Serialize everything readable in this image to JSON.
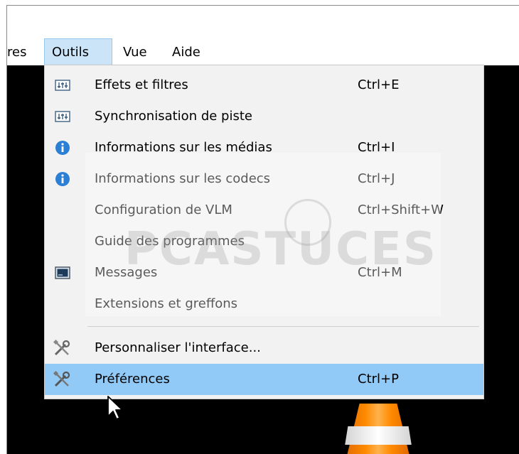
{
  "menubar": {
    "items": [
      {
        "label": "res"
      },
      {
        "label": "Outils"
      },
      {
        "label": "Vue"
      },
      {
        "label": "Aide"
      }
    ]
  },
  "menu": {
    "items": [
      {
        "label": "Effets et filtres",
        "shortcut": "Ctrl+E",
        "icon": "equalizer-icon"
      },
      {
        "label": "Synchronisation de piste",
        "shortcut": "",
        "icon": "equalizer-icon"
      },
      {
        "label": "Informations sur les médias",
        "shortcut": "Ctrl+I",
        "icon": "info-icon"
      },
      {
        "label": "Informations sur les codecs",
        "shortcut": "Ctrl+J",
        "icon": "info-icon"
      },
      {
        "label": "Configuration de VLM",
        "shortcut": "Ctrl+Shift+W",
        "icon": ""
      },
      {
        "label": "Guide des programmes",
        "shortcut": "",
        "icon": ""
      },
      {
        "label": "Messages",
        "shortcut": "Ctrl+M",
        "icon": "console-icon"
      },
      {
        "label": "Extensions et greffons",
        "shortcut": "",
        "icon": ""
      },
      {
        "label": "Personnaliser l'interface...",
        "shortcut": "",
        "icon": "tools-icon"
      },
      {
        "label": "Préférences",
        "shortcut": "Ctrl+P",
        "icon": "tools-icon"
      }
    ]
  },
  "watermark": {
    "text": "PCASTUCES"
  },
  "colors": {
    "menu_bg": "#f2f2f2",
    "highlight": "#91c9f7",
    "menubar_active": "#cce4f7",
    "video_bg": "#000000",
    "cone": "#ff8a00"
  }
}
